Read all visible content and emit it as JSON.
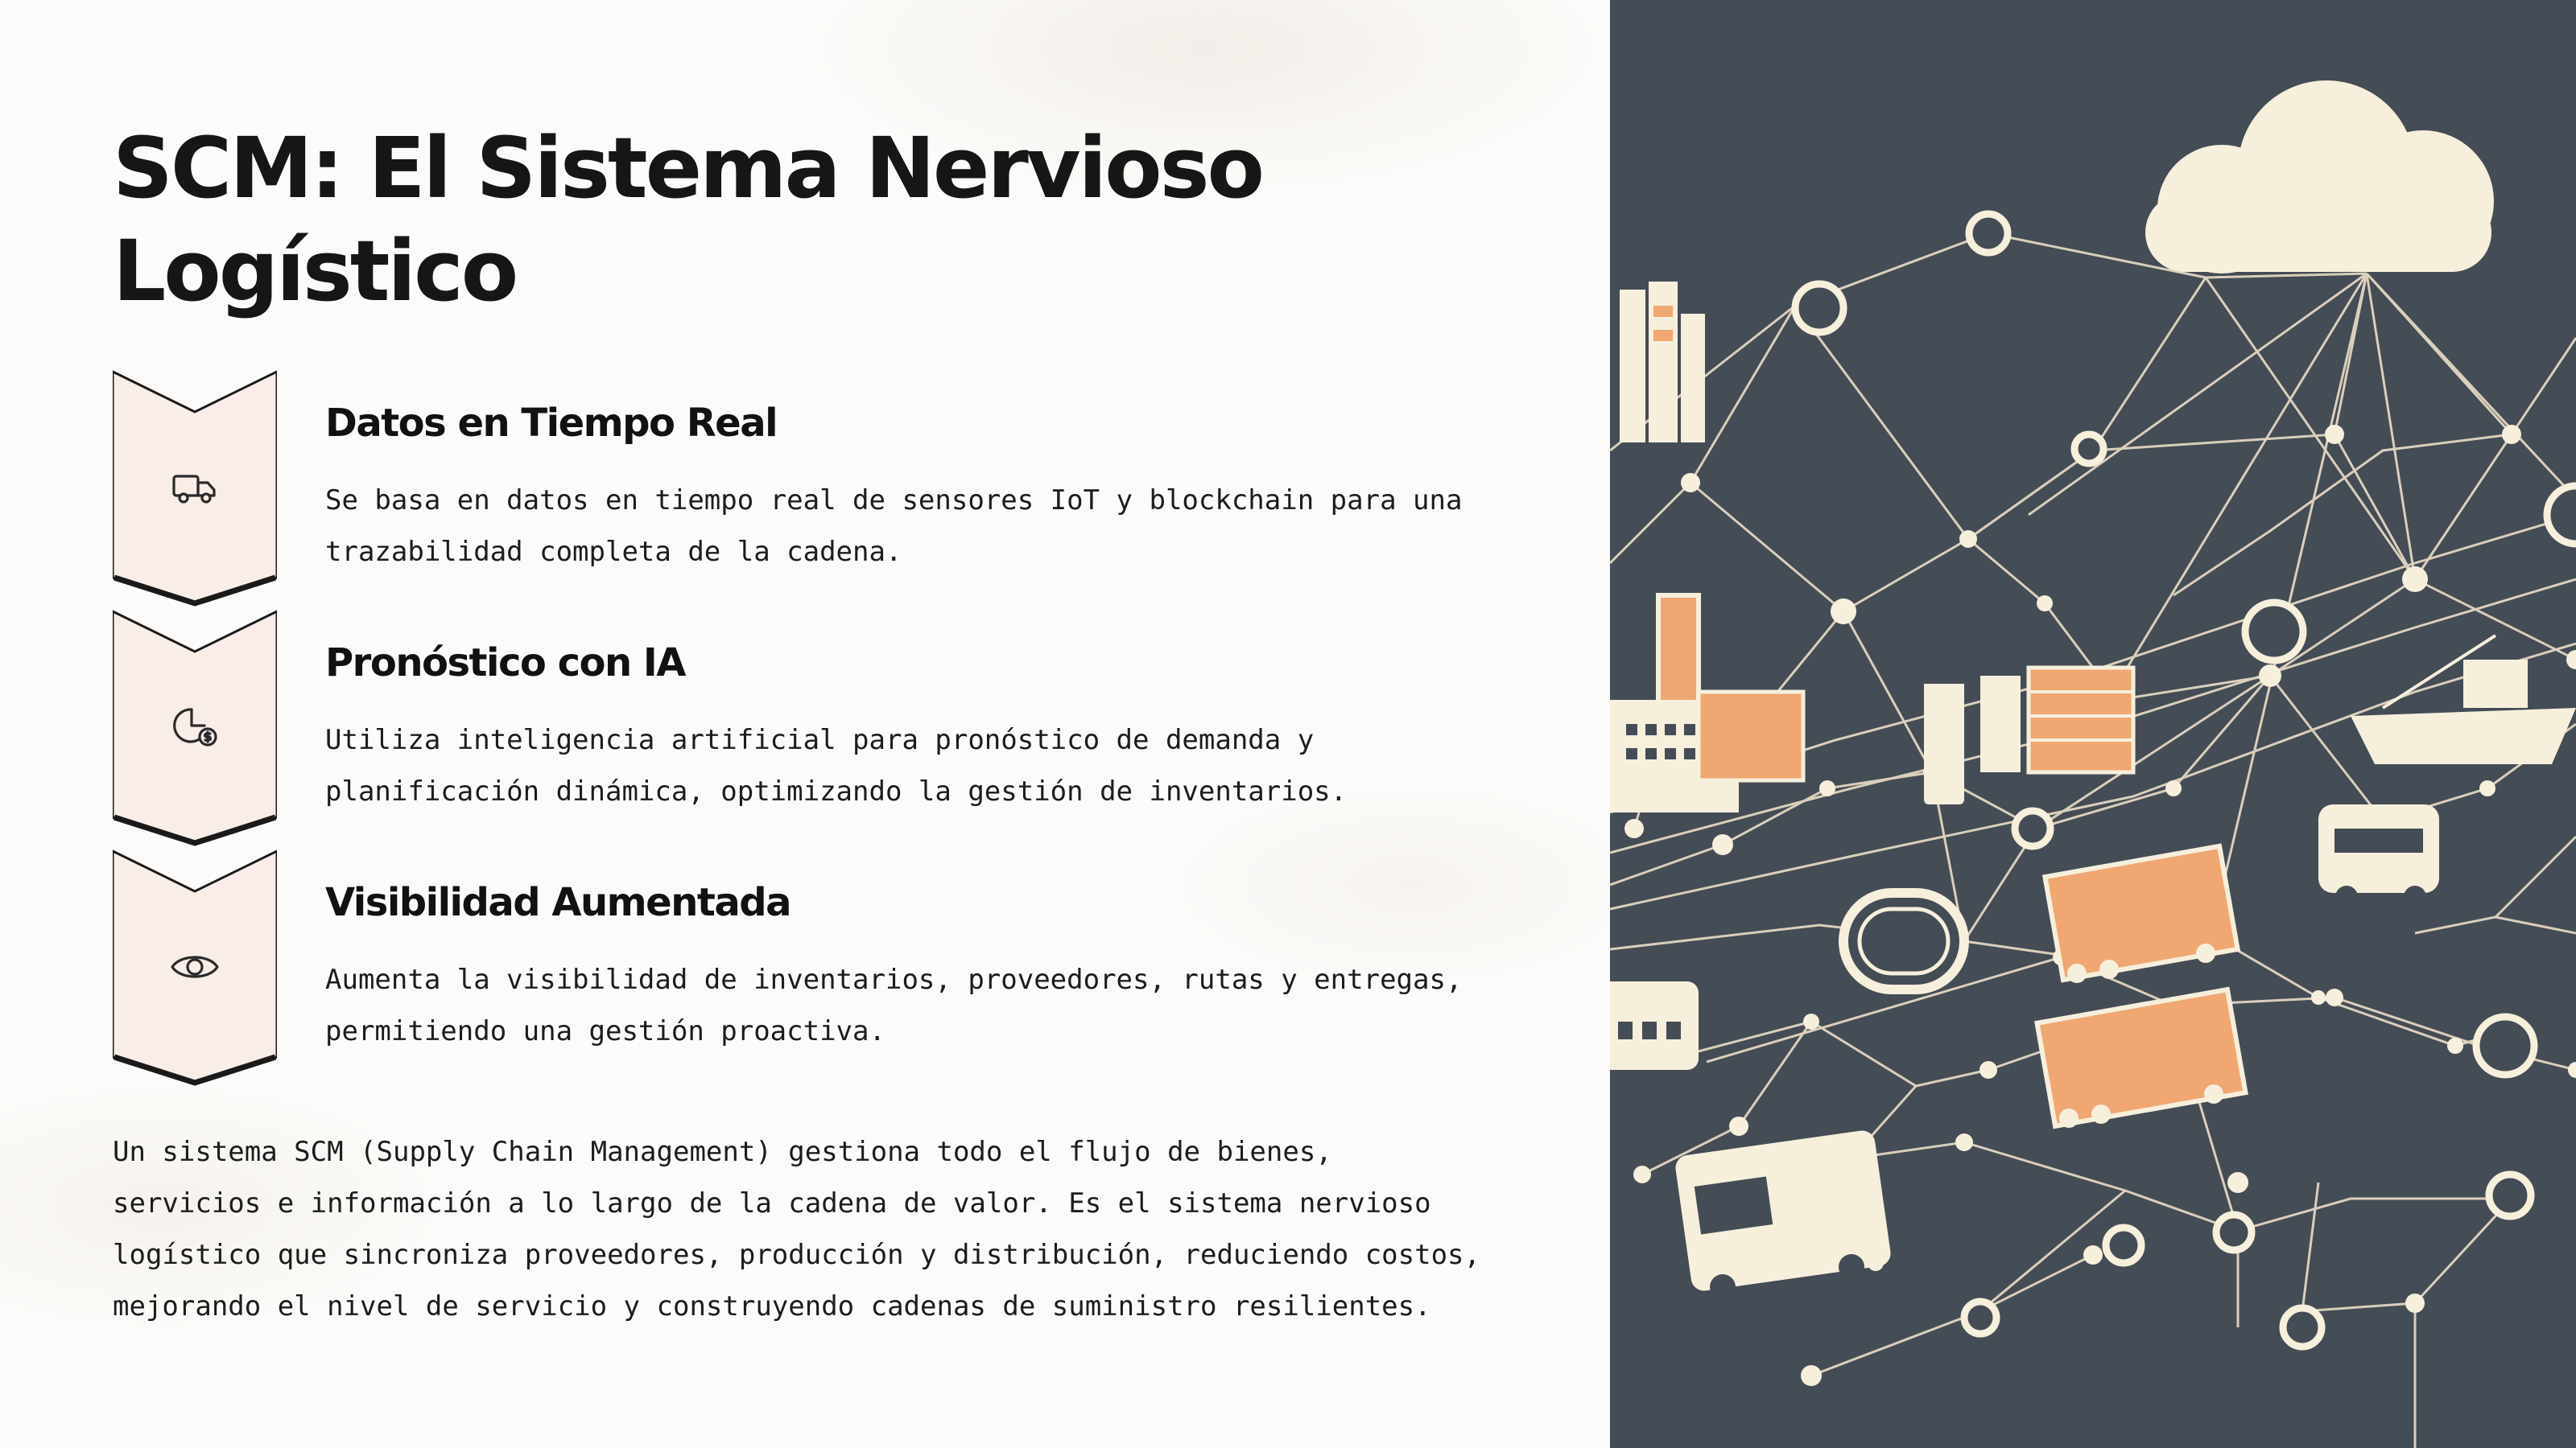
{
  "slide": {
    "title": "SCM: El Sistema Nervioso Logístico",
    "features": [
      {
        "icon": "truck-icon",
        "title": "Datos en Tiempo Real",
        "description": "Se basa en datos en tiempo real de sensores IoT y blockchain para una trazabilidad completa de la cadena."
      },
      {
        "icon": "chart-dollar-icon",
        "title": "Pronóstico con IA",
        "description": "Utiliza inteligencia artificial para pronóstico de demanda y planificación dinámica, optimizando la gestión de inventarios."
      },
      {
        "icon": "eye-icon",
        "title": "Visibilidad Aumentada",
        "description": "Aumenta la visibilidad de inventarios, proveedores, rutas y entregas, permitiendo una gestión proactiva."
      }
    ],
    "summary": "Un sistema SCM (Supply Chain Management) gestiona todo el flujo de bienes, servicios e información a lo largo de la cadena de valor. Es el sistema nervioso logístico que sincroniza proveedores, producción y distribución, reduciendo costos, mejorando el nivel de servicio y construyendo cadenas de suministro resilientes."
  },
  "colors": {
    "title": "#161616",
    "chevron_fill": "#f8ede7",
    "chevron_stroke": "#1a1a1a",
    "illustration_bg": "#444c55",
    "illustration_line": "#e8dcc8",
    "illustration_cream": "#f6efdc",
    "illustration_orange": "#f0a772"
  },
  "illustration": {
    "subject": "supply-chain-network-illustration",
    "elements": [
      "cloud-icon",
      "factory-icon",
      "warehouse-icon",
      "ship-icon",
      "truck-icon",
      "bus-icon",
      "train-icon",
      "network-nodes"
    ]
  }
}
